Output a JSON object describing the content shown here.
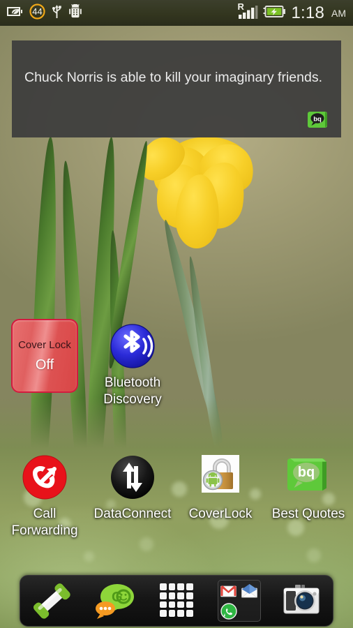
{
  "status_bar": {
    "left_icons": [
      {
        "name": "eco-battery-icon",
        "glyph": "leaf-battery"
      },
      {
        "name": "notification-count-badge",
        "label": "44"
      },
      {
        "name": "usb-icon",
        "glyph": "usb"
      },
      {
        "name": "android-debug-icon",
        "glyph": "android-debug"
      }
    ],
    "right_icons": [
      {
        "name": "roaming-signal-icon",
        "label": "R"
      },
      {
        "name": "battery-charging-icon",
        "glyph": "battery-charging"
      }
    ],
    "clock": "1:18",
    "meridiem": "AM",
    "colors": {
      "background": "#33361f",
      "text": "#f2f2ee",
      "accent": "#f0a818",
      "battery_green": "#7cc126"
    }
  },
  "quote_widget": {
    "name": "best-quotes-widget",
    "text": "Chuck Norris is able to kill your imaginary friends.",
    "badge_name": "bq-logo-icon",
    "badge_text": "bq",
    "background": "#3c3c3c",
    "badge_color": "#5ec93a"
  },
  "coverlock_widget": {
    "title": "Cover Lock",
    "state": "Off",
    "border_color": "#d31a3e",
    "fill_color": "#e06060"
  },
  "home_icons": [
    {
      "name": "bluetooth-discovery",
      "label": "Bluetooth Discovery",
      "icon_name": "bluetooth-discovery-icon",
      "color": "#2b2bd8"
    },
    {
      "name": "call-forwarding",
      "label": "Call Forwarding",
      "icon_name": "call-forwarding-icon",
      "color": "#e8121a"
    },
    {
      "name": "data-connect",
      "label": "DataConnect",
      "icon_name": "data-transfer-arrows-icon",
      "color": "#111111"
    },
    {
      "name": "cover-lock",
      "label": "CoverLock",
      "icon_name": "padlock-android-icon",
      "color": "#c9923c"
    },
    {
      "name": "best-quotes",
      "label": "Best Quotes",
      "icon_name": "bq-speech-bubble-icon",
      "color": "#5ec93a"
    }
  ],
  "dock": {
    "items": [
      {
        "name": "phone",
        "icon_name": "phone-handset-icon",
        "label": "Phone"
      },
      {
        "name": "go-sms",
        "icon_name": "go-sms-bubble-icon",
        "label": "GO SMS",
        "badge_text": "GO"
      },
      {
        "name": "app-drawer",
        "icon_name": "app-drawer-grid-icon",
        "label": "Apps"
      },
      {
        "name": "mail-folder",
        "icon_name": "folder-icon",
        "label": "Mail",
        "contents": [
          {
            "name": "gmail",
            "icon_name": "gmail-envelope-icon",
            "label": "Gmail"
          },
          {
            "name": "email",
            "icon_name": "email-envelope-icon",
            "label": "Email"
          },
          {
            "name": "whatsapp",
            "icon_name": "whatsapp-icon",
            "label": "WhatsApp"
          }
        ]
      },
      {
        "name": "camera",
        "icon_name": "camera-icon",
        "label": "Camera"
      }
    ]
  }
}
